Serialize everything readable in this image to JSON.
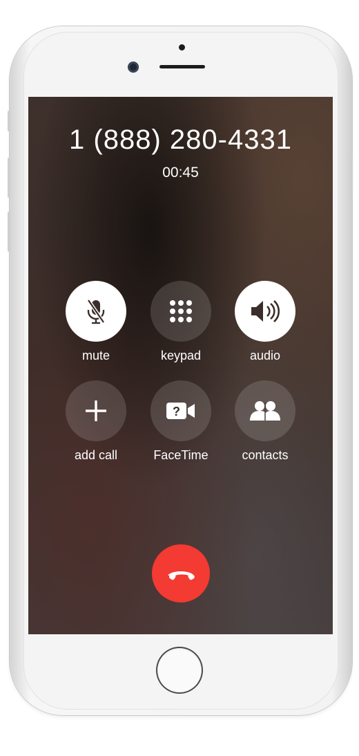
{
  "call": {
    "number": "1 (888) 280-4331",
    "duration": "00:45"
  },
  "buttons": [
    {
      "id": "mute",
      "label": "mute",
      "icon": "microphone-slash-icon",
      "active": true
    },
    {
      "id": "keypad",
      "label": "keypad",
      "icon": "keypad-grid-icon",
      "active": false
    },
    {
      "id": "audio",
      "label": "audio",
      "icon": "speaker-icon",
      "active": true
    },
    {
      "id": "add-call",
      "label": "add call",
      "icon": "plus-icon",
      "active": false
    },
    {
      "id": "facetime",
      "label": "FaceTime",
      "icon": "facetime-video-icon",
      "active": false
    },
    {
      "id": "contacts",
      "label": "contacts",
      "icon": "contacts-icon",
      "active": false
    }
  ],
  "end_call": {
    "icon": "end-call-phone-icon",
    "color": "#f33a33"
  },
  "colors": {
    "button_inactive_bg": "rgba(255,255,255,0.14)",
    "button_active_bg": "#ffffff",
    "text": "#ffffff"
  }
}
